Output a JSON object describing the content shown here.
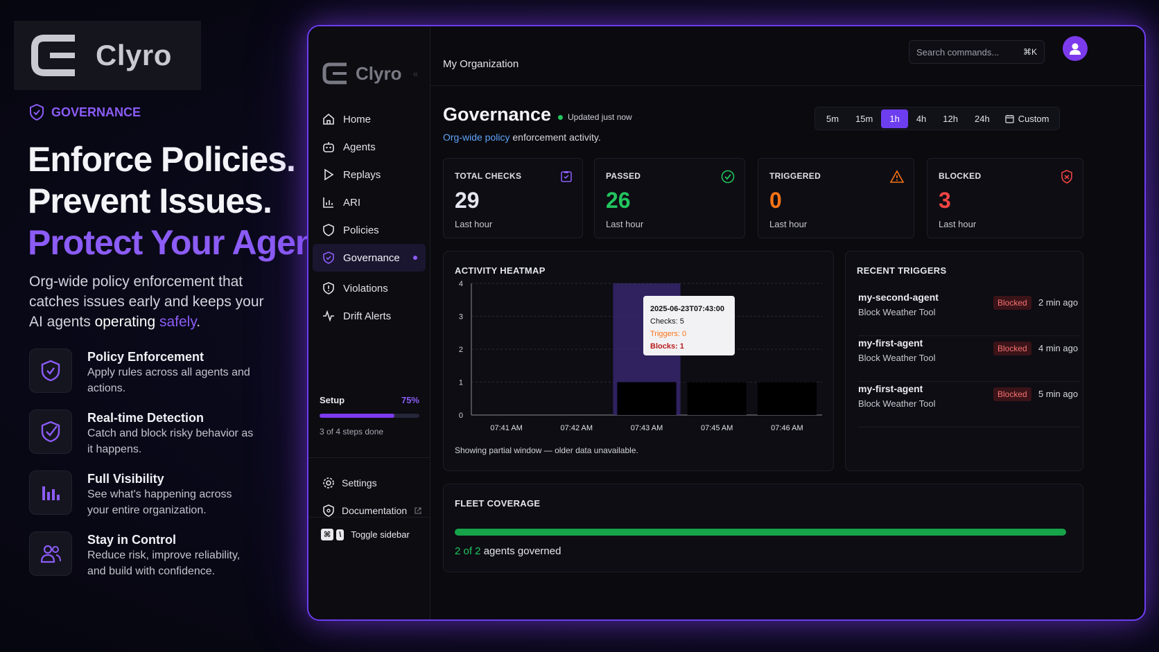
{
  "brand": {
    "name": "Clyro"
  },
  "hero": {
    "tag": "GOVERNANCE",
    "line1": "Enforce Policies.",
    "line2": "Prevent Issues.",
    "line3": "Protect Your Agents.",
    "lead_a": "Org-wide policy enforcement that catches issues early and keeps your AI agents ",
    "lead_b": "operating",
    "lead_c": "safely",
    "lead_d": "."
  },
  "features": [
    {
      "title": "Policy Enforcement",
      "desc": "Apply rules across all agents and actions.",
      "icon": "shield-check-icon"
    },
    {
      "title": "Real-time Detection",
      "desc": "Catch and block risky behavior as it happens.",
      "icon": "shield-check-icon"
    },
    {
      "title": "Full Visibility",
      "desc": "See what's happening across your entire organization.",
      "icon": "bar-chart-icon"
    },
    {
      "title": "Stay in Control",
      "desc": "Reduce risk, improve reliability, and build with confidence.",
      "icon": "users-icon"
    }
  ],
  "app": {
    "sidebar": {
      "brand": "Clyro",
      "collapse": "«",
      "items": [
        {
          "label": "Home",
          "icon": "home-icon"
        },
        {
          "label": "Agents",
          "icon": "robot-icon"
        },
        {
          "label": "Replays",
          "icon": "play-icon"
        },
        {
          "label": "ARI",
          "icon": "chart-icon"
        },
        {
          "label": "Policies",
          "icon": "shield-icon"
        },
        {
          "label": "Governance",
          "icon": "shield-check-icon",
          "active": true
        },
        {
          "label": "Violations",
          "icon": "alert-shield-icon"
        },
        {
          "label": "Drift Alerts",
          "icon": "activity-icon"
        }
      ],
      "setup": {
        "label": "Setup",
        "percent_label": "75%",
        "progress": 0.75,
        "steps": "3 of 4 steps done"
      },
      "settings": "Settings",
      "documentation": "Documentation",
      "toggle_keys_1": "⌘",
      "toggle_keys_2": "\\",
      "toggle": "Toggle sidebar"
    },
    "topbar": {
      "org": "My Organization",
      "search_placeholder": "Search commands...",
      "search_shortcut": "⌘K"
    },
    "header": {
      "title": "Governance",
      "updated": "Updated just now",
      "subtitle_accent": "Org-wide policy",
      "subtitle_rest": " enforcement activity."
    },
    "ranges": [
      "5m",
      "15m",
      "1h",
      "4h",
      "12h",
      "24h"
    ],
    "range_active": "1h",
    "range_custom": "Custom",
    "stats": [
      {
        "label": "TOTAL CHECKS",
        "value": "29",
        "sub": "Last hour",
        "color": "#e6e6f0",
        "icon": "clipboard-check-icon"
      },
      {
        "label": "PASSED",
        "value": "26",
        "sub": "Last hour",
        "color": "#22c55e",
        "icon": "check-circle-icon"
      },
      {
        "label": "TRIGGERED",
        "value": "0",
        "sub": "Last hour",
        "color": "#f97316",
        "icon": "warning-icon"
      },
      {
        "label": "BLOCKED",
        "value": "3",
        "sub": "Last hour",
        "color": "#ef4444",
        "icon": "shield-x-icon"
      }
    ],
    "heatmap": {
      "title": "ACTIVITY HEATMAP",
      "note": "Showing partial window — older data unavailable.",
      "tooltip": {
        "date": "2025-06-23T07:43:00",
        "checks": "Checks: 5",
        "triggers": "Triggers: 0",
        "blocks": "Blocks: 1"
      }
    },
    "triggers": {
      "title": "RECENT TRIGGERS",
      "items": [
        {
          "agent": "my-second-agent",
          "policy": "Block Weather Tool",
          "status": "Blocked",
          "time": "2 min ago"
        },
        {
          "agent": "my-first-agent",
          "policy": "Block Weather Tool",
          "status": "Blocked",
          "time": "4 min ago"
        },
        {
          "agent": "my-first-agent",
          "policy": "Block Weather Tool",
          "status": "Blocked",
          "time": "5 min ago"
        }
      ]
    },
    "fleet": {
      "title": "FLEET COVERAGE",
      "count": "2 of 2",
      "rest": " agents governed",
      "coverage": 1.0
    }
  },
  "chart_data": {
    "type": "bar",
    "title": "ACTIVITY HEATMAP",
    "categories": [
      "07:41 AM",
      "07:42 AM",
      "07:43 AM",
      "07:45 AM",
      "07:46 AM"
    ],
    "values": [
      0,
      0,
      1,
      1,
      1
    ],
    "yticks": [
      0,
      1,
      2,
      3,
      4
    ],
    "ylim": [
      0,
      4
    ],
    "highlight": "07:43 AM",
    "grid": true
  }
}
